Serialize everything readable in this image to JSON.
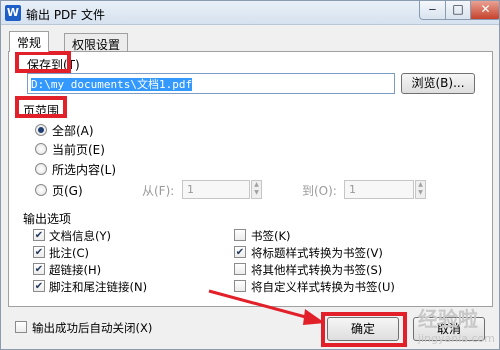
{
  "window": {
    "title": "输出 PDF 文件",
    "logo": "W",
    "controls": {
      "minimize": "‒",
      "maximize": "□",
      "close": "✕"
    }
  },
  "tabs": [
    {
      "label": "常规",
      "active": true
    },
    {
      "label": "权限设置",
      "active": false
    }
  ],
  "save_to": {
    "label": "保存到(T)",
    "path_value": "D:\\my documents\\文档1.pdf",
    "browse_button": "浏览(B)..."
  },
  "page_range": {
    "label": "页范围",
    "options": [
      {
        "label": "全部(A)",
        "selected": true
      },
      {
        "label": "当前页(E)",
        "selected": false
      },
      {
        "label": "所选内容(L)",
        "selected": false
      },
      {
        "label": "页(G)",
        "selected": false
      }
    ],
    "from_label": "从(F):",
    "from_value": "1",
    "to_label": "到(O):",
    "to_value": "1"
  },
  "output_options": {
    "label": "输出选项",
    "left": [
      {
        "label": "文档信息(Y)",
        "checked": true
      },
      {
        "label": "批注(C)",
        "checked": true
      },
      {
        "label": "超链接(H)",
        "checked": true
      },
      {
        "label": "脚注和尾注链接(N)",
        "checked": true
      }
    ],
    "right": [
      {
        "label": "书签(K)",
        "checked": false
      },
      {
        "label": "将标题样式转换为书签(V)",
        "checked": true
      },
      {
        "label": "将其他样式转换为书签(S)",
        "checked": false
      },
      {
        "label": "将自定义样式转换为书签(U)",
        "checked": false
      }
    ]
  },
  "footer": {
    "auto_close_label": "输出成功后自动关闭(X)",
    "auto_close_checked": false,
    "ok_button": "确定",
    "cancel_button": "取消"
  },
  "annotation_colors": {
    "highlight": "#e2202a",
    "arrow": "#e2202a"
  },
  "watermark": {
    "text": "经验啦",
    "sub": "jingyanla.com"
  }
}
